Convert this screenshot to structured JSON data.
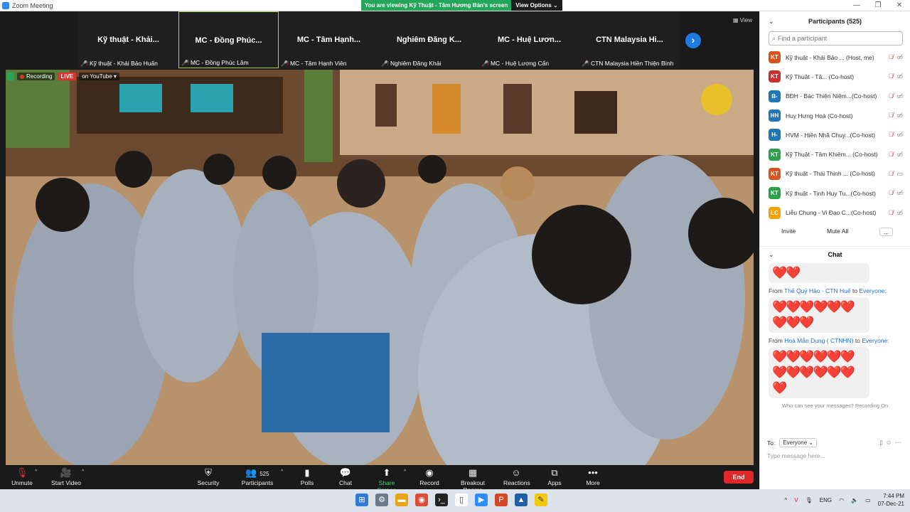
{
  "window": {
    "title": "Zoom Meeting",
    "controls": [
      "—",
      "❐",
      "✕"
    ]
  },
  "share_banner": {
    "text": "You are viewing Kỹ Thuật - Tâm Hương Bản's screen",
    "options_label": "View Options ⌄"
  },
  "view_label": "View",
  "thumbnails": [
    {
      "big": "Kỹ thuật - Khải...",
      "small": "Kỹ thuật - Khải Bảo Huấn",
      "active": false
    },
    {
      "big": "MC - Đồng Phúc...",
      "small": "MC - Đồng Phúc Lâm",
      "active": true
    },
    {
      "big": "MC - Tâm Hạnh...",
      "small": "MC - Tâm Hạnh Viên",
      "active": false
    },
    {
      "big": "Nghiêm Đăng K...",
      "small": "Nghiêm Đăng Khải",
      "active": false
    },
    {
      "big": "MC - Huệ Lươn...",
      "small": "MC - Huệ Lương Cẩn",
      "active": false
    },
    {
      "big": "CTN Malaysia Hi...",
      "small": "CTN Malaysia Hiền Thiện Bình",
      "active": false
    }
  ],
  "video_status": {
    "recording": "Recording",
    "live": "LIVE",
    "youtube": "on YouTube ▾"
  },
  "toolbar": {
    "unmute": "Unmute",
    "start_video": "Start Video",
    "security": "Security",
    "participants": "Participants",
    "participant_count": "525",
    "polls": "Polls",
    "chat": "Chat",
    "share_screen": "Share Screen",
    "record": "Record",
    "breakout": "Breakout Rooms",
    "reactions": "Reactions",
    "apps": "Apps",
    "more": "More",
    "end": "End"
  },
  "participants_panel": {
    "title": "Participants (525)",
    "search_placeholder": "Find a participant",
    "items": [
      {
        "initials": "KT",
        "color": "#d9531e",
        "name": "Kỹ thuật - Khải Bảo ...  (Host, me)"
      },
      {
        "initials": "KT",
        "color": "#c8312d",
        "name": "Kỹ Thuật - Tâ...  (Co-host)"
      },
      {
        "initials": "B-",
        "color": "#1f77b4",
        "name": "BĐH - Bác Thiện Niệm...(Co-host)"
      },
      {
        "initials": "HH",
        "color": "#1f77b4",
        "name": "Huy Hưng Hoà (Co-host)"
      },
      {
        "initials": "H-",
        "color": "#1f77b4",
        "name": "HVM - Hiền Nhã Chuy...(Co-host)"
      },
      {
        "initials": "KT",
        "color": "#2ca04a",
        "name": "Kỹ Thuật - Tâm Khiêm... (Co-host)"
      },
      {
        "initials": "KT",
        "color": "#d9531e",
        "name": "Kỹ thuật - Thái Thịnh ... (Co-host)"
      },
      {
        "initials": "KT",
        "color": "#2ca04a",
        "name": "Kỹ thuật - Tịnh Huy Tu...(Co-host)"
      },
      {
        "initials": "LC",
        "color": "#f0a30a",
        "name": "Liễu Chung - Vi Đạo C...(Co-host)"
      }
    ],
    "invite": "Invite",
    "mute_all": "Mute All",
    "more": "..."
  },
  "chat_panel": {
    "title": "Chat",
    "messages": [
      {
        "from": "",
        "sender": "",
        "to": "",
        "hearts": "❤️❤️"
      },
      {
        "from": "From",
        "sender": "Thế Quý Hảo - CTN Huế",
        "to": "Everyone:",
        "hearts": "❤️❤️❤️❤️❤️❤️❤️❤️❤️"
      },
      {
        "from": "From",
        "sender": "Hoà Mẫn Dung ( CTNHN)",
        "to": "Everyone:",
        "hearts": "❤️❤️❤️❤️❤️❤️❤️❤️❤️❤️❤️❤️❤️"
      }
    ],
    "visibility": "Who can see your messages? Recording On",
    "to_label": "To:",
    "to_value": "Everyone ⌄",
    "input_placeholder": "Type message here..."
  },
  "taskbar": {
    "lang": "ENG",
    "time": "7:44 PM",
    "date": "07-Dec-21"
  }
}
